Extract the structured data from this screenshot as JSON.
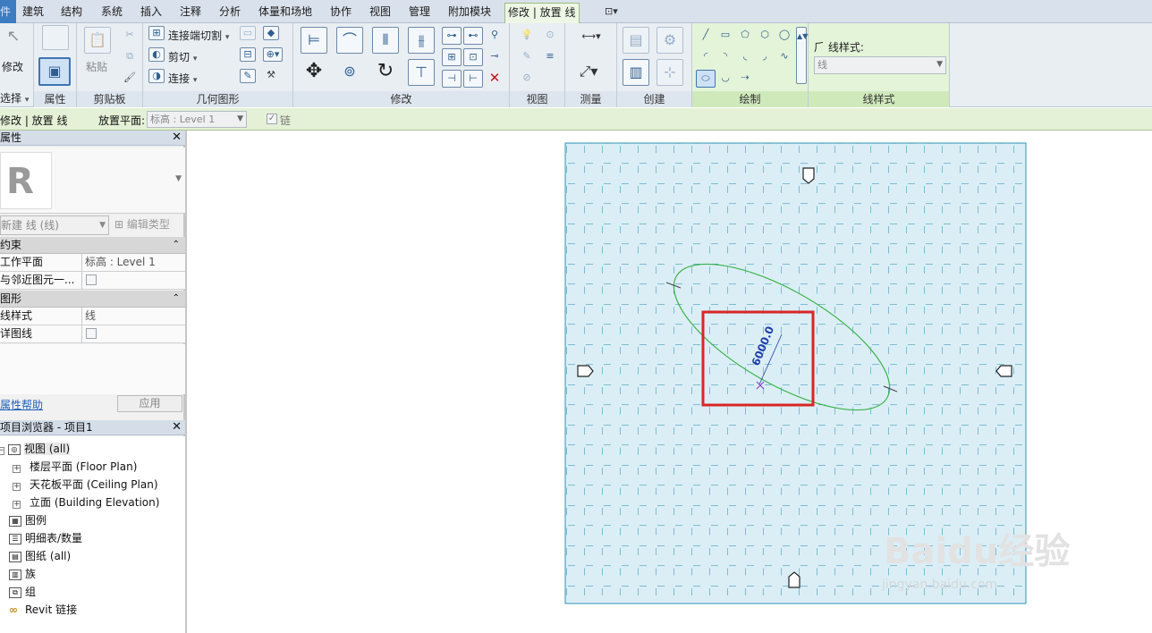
{
  "menubar": {
    "file_tab": "件",
    "tabs": [
      "建筑",
      "结构",
      "系统",
      "插入",
      "注释",
      "分析",
      "体量和场地",
      "协作",
      "视图",
      "管理",
      "附加模块"
    ],
    "active_tab": "修改 | 放置 线",
    "extra_dropdown": "⊡▾"
  },
  "ribbon": {
    "select": {
      "modify_label": "修改",
      "title": "选择",
      "title_arrow": "▾"
    },
    "properties": {
      "title": "属性"
    },
    "clipboard": {
      "paste_label": "粘贴",
      "title": "剪贴板"
    },
    "geometry": {
      "join_cut": "连接端切割",
      "cut": "剪切",
      "join": "连接",
      "title": "几何图形"
    },
    "modify": {
      "title": "修改"
    },
    "view": {
      "title": "视图"
    },
    "measure": {
      "title": "测量"
    },
    "create": {
      "title": "创建"
    },
    "draw": {
      "title": "绘制"
    },
    "linestyle": {
      "label": "线样式:",
      "value": "线",
      "title": "线样式"
    }
  },
  "optionsbar": {
    "context": "修改 | 放置 线",
    "placement_label": "放置平面:",
    "placement_value": "标高 : Level 1",
    "chain_label": "链",
    "chain_checked": true
  },
  "properties": {
    "header": "属性",
    "type_selector": "新建 线 (线)",
    "edit_type": "编辑类型",
    "groups": [
      {
        "name": "约束",
        "rows": [
          {
            "key": "工作平面",
            "value": "标高 : Level 1"
          },
          {
            "key": "与邻近图元一...",
            "value": ""
          }
        ]
      },
      {
        "name": "图形",
        "rows": [
          {
            "key": "线样式",
            "value": "线"
          },
          {
            "key": "详图线",
            "value": ""
          }
        ]
      }
    ],
    "help_link": "属性帮助",
    "apply": "应用"
  },
  "browser": {
    "header": "项目浏览器 - 项目1",
    "items": [
      {
        "label": "视图 (all)",
        "level": 0,
        "icon": "views-icon"
      },
      {
        "label": "楼层平面 (Floor Plan)",
        "level": 1
      },
      {
        "label": "天花板平面 (Ceiling Plan)",
        "level": 1
      },
      {
        "label": "立面 (Building Elevation)",
        "level": 1
      },
      {
        "label": "图例",
        "level": 0,
        "icon": "legend-icon"
      },
      {
        "label": "明细表/数量",
        "level": 0,
        "icon": "schedule-icon"
      },
      {
        "label": "图纸 (all)",
        "level": 0,
        "icon": "sheet-icon"
      },
      {
        "label": "族",
        "level": 0,
        "icon": "family-icon"
      },
      {
        "label": "组",
        "level": 0,
        "icon": "group-icon"
      },
      {
        "label": "Revit 链接",
        "level": 0,
        "icon": "link-icon"
      }
    ]
  },
  "canvas": {
    "dimension_text": "6000.0",
    "colors": {
      "background": "#dbeef6",
      "grid": "#2c93b6",
      "ellipse": "#3bb34a",
      "highlight": "#d92626",
      "dimension": "#1f3fa8"
    }
  },
  "watermark": {
    "brand": "Baidu经验",
    "url": "jingyan.baidu.com"
  }
}
